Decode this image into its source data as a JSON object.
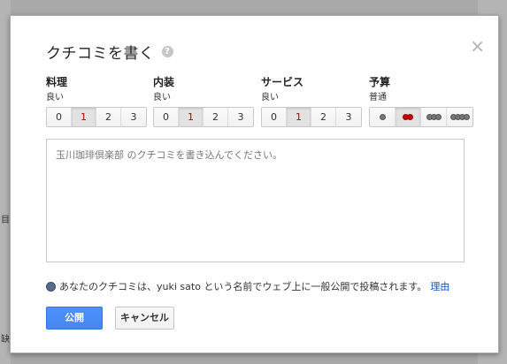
{
  "background": {
    "left_glyph_1": "目",
    "left_glyph_2": "缺"
  },
  "dialog": {
    "title": "クチコミを書く",
    "help_icon": "?",
    "close_icon": "×"
  },
  "categories": [
    {
      "title": "料理",
      "value": "良い",
      "options": [
        "0",
        "1",
        "2",
        "3"
      ],
      "selected": "1"
    },
    {
      "title": "内装",
      "value": "良い",
      "options": [
        "0",
        "1",
        "2",
        "3"
      ],
      "selected": "1"
    },
    {
      "title": "サービス",
      "value": "良い",
      "options": [
        "0",
        "1",
        "2",
        "3"
      ],
      "selected": "1"
    }
  ],
  "price": {
    "title": "予算",
    "value": "普通",
    "options_icon": "coin-icon",
    "selected_index": 1
  },
  "review": {
    "placeholder": "玉川珈琲倶楽部 のクチコミを書き込んでください。"
  },
  "notice": {
    "text": "あなたのクチコミは、yuki sato という名前でウェブ上に一般公開で投稿されます。",
    "link": "理由"
  },
  "buttons": {
    "publish": "公開",
    "cancel": "キャンセル"
  },
  "colors": {
    "primary": "#4d90fe",
    "selected_text": "#b30000",
    "link": "#1155cc"
  }
}
